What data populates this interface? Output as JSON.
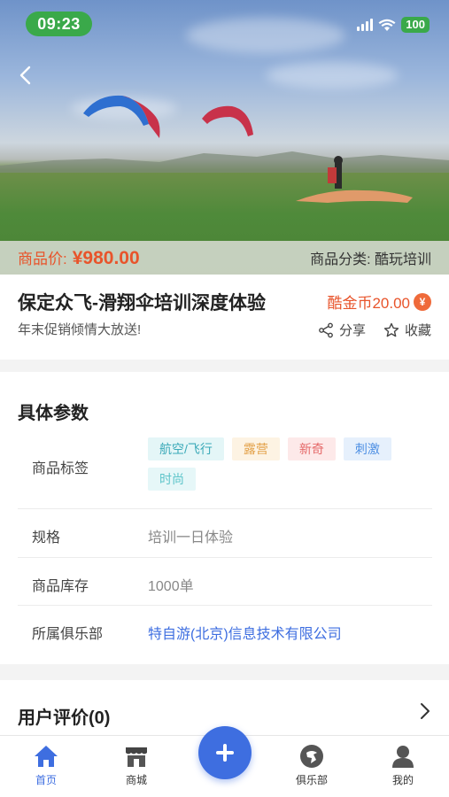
{
  "status_bar": {
    "time": "09:23",
    "battery": "100"
  },
  "hero": {
    "price_label": "商品价:",
    "price_value": "¥980.00",
    "category": "商品分类: 酷玩培训"
  },
  "product": {
    "title": "保定众飞-滑翔伞培训深度体验",
    "subtitle": "年末促销倾情大放送!",
    "coin_text": "酷金币20.00",
    "coin_symbol": "¥",
    "share_label": "分享",
    "favorite_label": "收藏"
  },
  "params": {
    "title": "具体参数",
    "tags_label": "商品标签",
    "tags": [
      {
        "text": "航空/飞行",
        "color": "#3aa9b8",
        "bg": "#e4f6f7"
      },
      {
        "text": "露营",
        "color": "#e3a24a",
        "bg": "#fdf3e3"
      },
      {
        "text": "新奇",
        "color": "#e56a6a",
        "bg": "#fde9e9"
      },
      {
        "text": "刺激",
        "color": "#4d8fe3",
        "bg": "#e6f0fc"
      },
      {
        "text": "时尚",
        "color": "#5cc4c9",
        "bg": "#e6f7f8"
      }
    ],
    "spec_label": "规格",
    "spec_value": "培训一日体验",
    "stock_label": "商品库存",
    "stock_value": "1000单",
    "club_label": "所属俱乐部",
    "club_value": "特自游(北京)信息技术有限公司"
  },
  "reviews": {
    "title": "用户评价(0)"
  },
  "tabbar": {
    "home": "首页",
    "mall": "商城",
    "club": "俱乐部",
    "mine": "我的"
  },
  "colors": {
    "accent": "#3e6ee0",
    "price": "#e8542b",
    "club_link": "#3e6ee0"
  }
}
